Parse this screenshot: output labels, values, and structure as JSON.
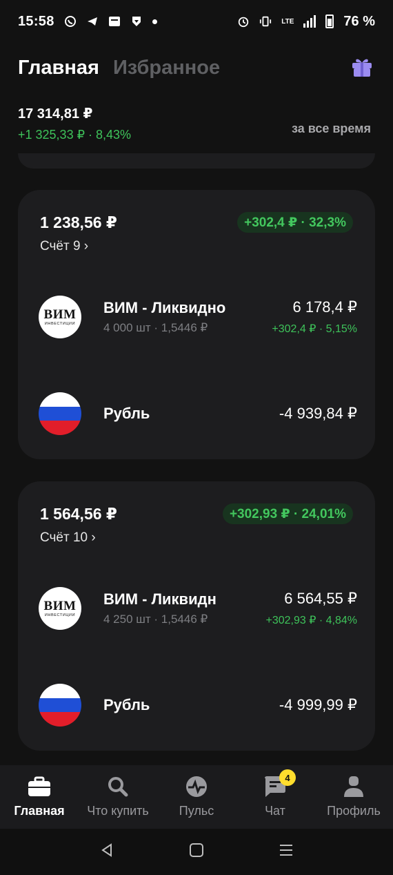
{
  "status_bar": {
    "time": "15:58",
    "battery_percent": "76 %",
    "network": "LTE"
  },
  "header": {
    "tabs": [
      {
        "label": "Главная",
        "active": true
      },
      {
        "label": "Избранное",
        "active": false
      }
    ],
    "gift_icon": "gift-icon"
  },
  "summary": {
    "total": "17 314,81 ₽",
    "gain": "+1 325,33 ₽ · 8,43%",
    "period": "за все время"
  },
  "accounts": [
    {
      "total": "1 238,56 ₽",
      "name": "Счёт 9 ›",
      "gain_badge": "+302,4 ₽ · 32,3%",
      "positions": [
        {
          "name": "ВИМ - Ликвидно",
          "sub": "4 000 шт · 1,5446 ₽",
          "value": "6 178,4 ₽",
          "gain": "+302,4 ₽ · 5,15%"
        },
        {
          "name": "Рубль",
          "value": "-4 939,84 ₽"
        }
      ]
    },
    {
      "total": "1 564,56 ₽",
      "name": "Счёт 10 ›",
      "gain_badge": "+302,93 ₽ · 24,01%",
      "positions": [
        {
          "name": "ВИМ - Ликвидн",
          "sub": "4 250 шт · 1,5446 ₽",
          "value": "6 564,55 ₽",
          "gain": "+302,93 ₽ · 4,84%"
        },
        {
          "name": "Рубль",
          "value": "-4 999,99 ₽"
        }
      ]
    }
  ],
  "logo_text": {
    "main": "ВИМ",
    "sub": "ИНВЕСТИЦИИ"
  },
  "bottom_nav": [
    {
      "label": "Главная",
      "icon": "briefcase-icon",
      "active": true
    },
    {
      "label": "Что купить",
      "icon": "search-icon",
      "active": false
    },
    {
      "label": "Пульс",
      "icon": "pulse-icon",
      "active": false
    },
    {
      "label": "Чат",
      "icon": "chat-icon",
      "active": false,
      "badge": "4"
    },
    {
      "label": "Профиль",
      "icon": "profile-icon",
      "active": false
    }
  ],
  "colors": {
    "background": "#121212",
    "card": "#1d1d1f",
    "positive": "#3ec35a",
    "badge_bg": "#18341f",
    "chat_badge": "#ffdd2d",
    "gift": "#9b8cf0"
  }
}
